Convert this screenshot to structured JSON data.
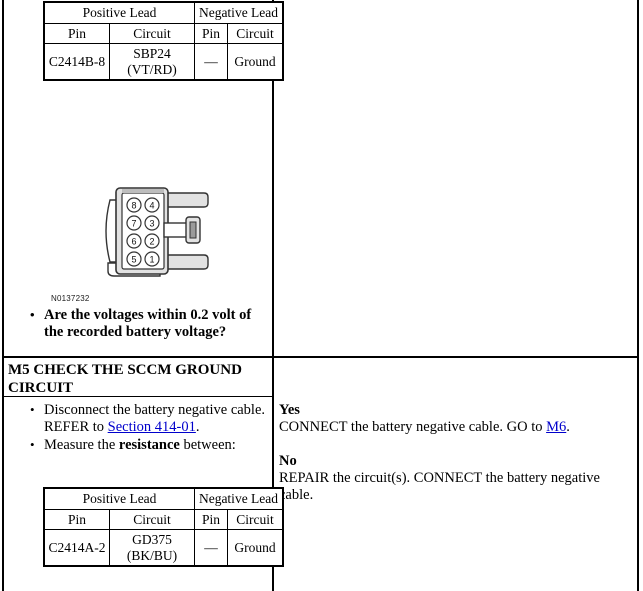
{
  "document": {
    "figure_caption": "N0137232"
  },
  "lead_table_headers": {
    "positive_lead": "Positive Lead",
    "negative_lead": "Negative Lead",
    "pin": "Pin",
    "circuit": "Circuit"
  },
  "lead_table_1": {
    "positive_pin": "C2414B-8",
    "positive_circuit": "SBP24 (VT/RD)",
    "negative_pin": "—",
    "negative_circuit": "Ground"
  },
  "lead_table_2": {
    "positive_pin": "C2414A-2",
    "positive_circuit": "GD375 (BK/BU)",
    "negative_pin": "—",
    "negative_circuit": "Ground"
  },
  "connector": {
    "pins_left": [
      "8",
      "7",
      "6",
      "5"
    ],
    "pins_right": [
      "4",
      "3",
      "2",
      "1"
    ]
  },
  "step_m4": {
    "question_line1": "Are the voltages within 0.2 volt of",
    "question_line2": "the recorded battery voltage?"
  },
  "step_m5": {
    "heading": "M5 CHECK THE SCCM GROUND CIRCUIT",
    "action_1_pre": "Disconnect the battery negative cable. REFER to ",
    "action_1_link": "Section 414-01",
    "action_1_post": ".",
    "action_2_pre": "Measure the ",
    "action_2_bold": "resistance",
    "action_2_post": " between:",
    "result": {
      "yes_label": "Yes",
      "yes_pre": "CONNECT the battery negative cable. GO to ",
      "yes_link": "M6",
      "yes_post": ".",
      "no_label": "No",
      "no_text": "REPAIR the circuit(s). CONNECT the battery negative cable."
    }
  },
  "colors": {
    "link": "#0000cc",
    "rule": "#000000",
    "connector_outline": "#222222",
    "connector_fill": "#d9d9d9"
  }
}
